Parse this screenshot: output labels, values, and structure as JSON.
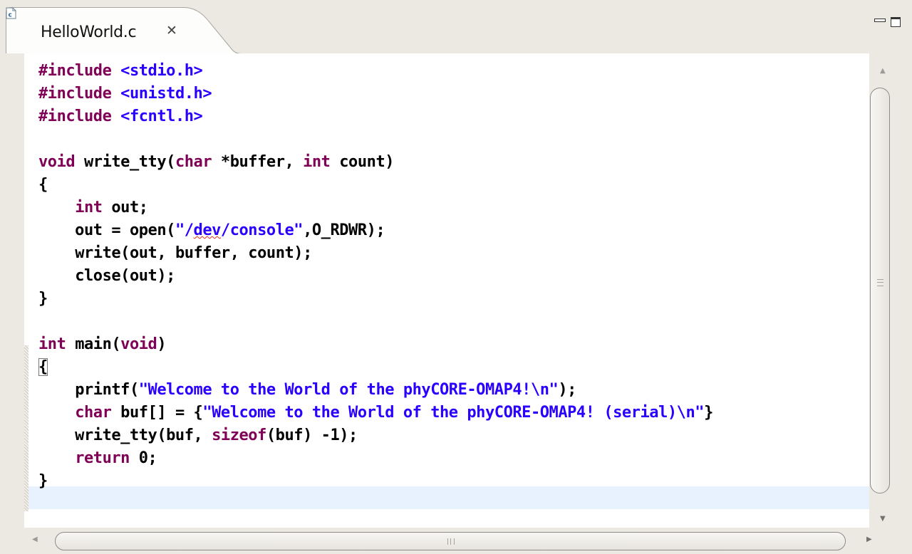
{
  "tab": {
    "title": "HelloWorld.c",
    "file_icon_letter": "c",
    "close_icon": "✕",
    "close_icon_name": "close-tab-icon"
  },
  "window_controls": {
    "minimize_icon": "minimize-icon",
    "maximize_icon": "maximize-icon"
  },
  "colors": {
    "keyword": "#7f0055",
    "string": "#2a00ff",
    "current_line": "#e8f2fe",
    "chrome": "#ece9e2"
  },
  "code": {
    "lines": [
      [
        [
          "kw",
          "#include"
        ],
        [
          "t",
          " "
        ],
        [
          "str",
          "<stdio.h>"
        ]
      ],
      [
        [
          "kw",
          "#include"
        ],
        [
          "t",
          " "
        ],
        [
          "str",
          "<unistd.h>"
        ]
      ],
      [
        [
          "kw",
          "#include"
        ],
        [
          "t",
          " "
        ],
        [
          "str",
          "<fcntl.h>"
        ]
      ],
      [],
      [
        [
          "kw",
          "void"
        ],
        [
          "t",
          " "
        ],
        [
          "fn",
          "write_tty"
        ],
        [
          "t",
          "("
        ],
        [
          "kw",
          "char"
        ],
        [
          "t",
          " *buffer, "
        ],
        [
          "kw",
          "int"
        ],
        [
          "t",
          " count)"
        ]
      ],
      [
        [
          "t",
          "{"
        ]
      ],
      [
        [
          "t",
          "    "
        ],
        [
          "kw",
          "int"
        ],
        [
          "t",
          " out;"
        ]
      ],
      [
        [
          "t",
          "    out = "
        ],
        [
          "fn",
          "open"
        ],
        [
          "t",
          "("
        ],
        [
          "str",
          "\"/"
        ],
        [
          "spell",
          "dev"
        ],
        [
          "str",
          "/console\""
        ],
        [
          "t",
          ",O_RDWR);"
        ]
      ],
      [
        [
          "t",
          "    "
        ],
        [
          "fn",
          "write"
        ],
        [
          "t",
          "(out, buffer, count);"
        ]
      ],
      [
        [
          "t",
          "    "
        ],
        [
          "fn",
          "close"
        ],
        [
          "t",
          "(out);"
        ]
      ],
      [
        [
          "t",
          "}"
        ]
      ],
      [],
      [
        [
          "kw",
          "int"
        ],
        [
          "t",
          " "
        ],
        [
          "fn",
          "main"
        ],
        [
          "t",
          "("
        ],
        [
          "kw",
          "void"
        ],
        [
          "t",
          ")"
        ]
      ],
      [
        [
          "bracket",
          "{"
        ]
      ],
      [
        [
          "t",
          "    "
        ],
        [
          "fn",
          "printf"
        ],
        [
          "t",
          "("
        ],
        [
          "str",
          "\"Welcome to the World of the phyCORE-OMAP4!\\n\""
        ],
        [
          "t",
          ");"
        ]
      ],
      [
        [
          "t",
          "    "
        ],
        [
          "kw",
          "char"
        ],
        [
          "t",
          " buf[] = {"
        ],
        [
          "str",
          "\"Welcome to the World of the phyCORE-OMAP4! (serial)\\n\""
        ],
        [
          "t",
          "}"
        ]
      ],
      [
        [
          "t",
          "    write_tty(buf, "
        ],
        [
          "kw",
          "sizeof"
        ],
        [
          "t",
          "(buf) -1);"
        ]
      ],
      [
        [
          "t",
          "    "
        ],
        [
          "kw",
          "return"
        ],
        [
          "t",
          " 0;"
        ]
      ],
      [
        [
          "t",
          "}"
        ]
      ]
    ]
  },
  "scrollbars": {
    "vertical": {
      "up_icon": "▲",
      "down_icon": "▼"
    },
    "horizontal": {
      "left_icon": "◀",
      "right_icon": "▶"
    }
  }
}
